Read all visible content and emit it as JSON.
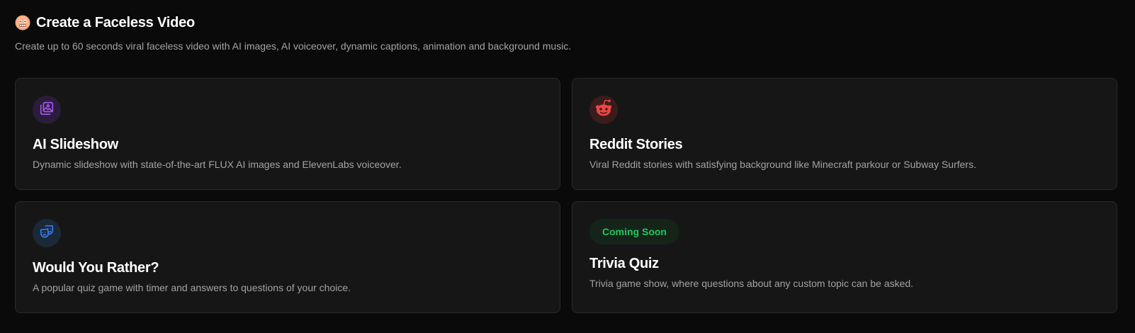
{
  "header": {
    "emoji_icon": "face-emoji-icon",
    "title": "Create a Faceless Video",
    "subtitle": "Create up to 60 seconds viral faceless video with AI images, AI voiceover, dynamic captions, animation and background music."
  },
  "cards": [
    {
      "icon": "image-gallery-icon",
      "icon_color": "#a855f7",
      "title": "AI Slideshow",
      "description": "Dynamic slideshow with state-of-the-art FLUX AI images and ElevenLabs voiceover."
    },
    {
      "icon": "reddit-icon",
      "icon_color": "#ef4444",
      "title": "Reddit Stories",
      "description": "Viral Reddit stories with satisfying background like Minecraft parkour or Subway Surfers."
    },
    {
      "icon": "theater-masks-icon",
      "icon_color": "#3b82f6",
      "title": "Would You Rather?",
      "description": "A popular quiz game with timer and answers to questions of your choice."
    },
    {
      "badge": "Coming Soon",
      "badge_color": "#22c55e",
      "title": "Trivia Quiz",
      "description": "Trivia game show, where questions about any custom topic can be asked."
    }
  ]
}
